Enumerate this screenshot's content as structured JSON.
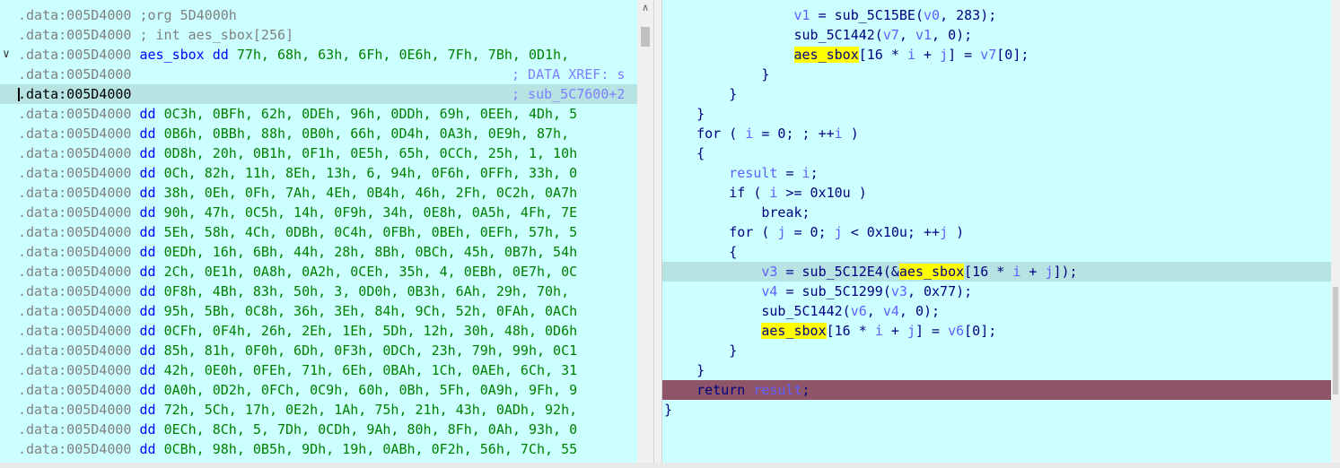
{
  "left": {
    "lines": [
      {
        "addr": ".data:005D4000",
        "rest": " ;org 5D4000h",
        "kind": "gray"
      },
      {
        "addr": ".data:005D4000",
        "rest": " ; int aes_sbox[256]",
        "kind": "gray"
      },
      {
        "addr": ".data:005D4000",
        "name": "aes_sbox",
        "dd": "dd",
        "vals": "77h, 68h, 63h, 6Fh, 0E6h, 7Fh, 7Bh, 0D1h,",
        "kind": "def"
      },
      {
        "addr": ".data:005D4000",
        "comment": "; DATA XREF: s",
        "kind": "comment"
      },
      {
        "addr": ".data:005D4000",
        "comment": "; sub_5C7600+2",
        "kind": "comment"
      },
      {
        "addr": ".data:005D4000",
        "dd": "dd",
        "vals": "0C3h, 0BFh, 62h, 0DEh, 96h, 0DDh, 69h, 0EEh, 4Dh, 5",
        "kind": "dd"
      },
      {
        "addr": ".data:005D4000",
        "dd": "dd",
        "vals": "0B6h, 0BBh, 88h, 0B0h, 66h, 0D4h, 0A3h, 0E9h, 87h,",
        "kind": "dd"
      },
      {
        "addr": ".data:005D4000",
        "dd": "dd",
        "vals": "0D8h, 20h, 0B1h, 0F1h, 0E5h, 65h, 0CCh, 25h, 1, 10h",
        "kind": "dd"
      },
      {
        "addr": ".data:005D4000",
        "dd": "dd",
        "vals": "0Ch, 82h, 11h, 8Eh, 13h, 6, 94h, 0F6h, 0FFh, 33h, 0",
        "kind": "dd"
      },
      {
        "addr": ".data:005D4000",
        "dd": "dd",
        "vals": "38h, 0Eh, 0Fh, 7Ah, 4Eh, 0B4h, 46h, 2Fh, 0C2h, 0A7h",
        "kind": "dd"
      },
      {
        "addr": ".data:005D4000",
        "dd": "dd",
        "vals": "90h, 47h, 0C5h, 14h, 0F9h, 34h, 0E8h, 0A5h, 4Fh, 7E",
        "kind": "dd"
      },
      {
        "addr": ".data:005D4000",
        "dd": "dd",
        "vals": "5Eh, 58h, 4Ch, 0DBh, 0C4h, 0FBh, 0BEh, 0EFh, 57h, 5",
        "kind": "dd"
      },
      {
        "addr": ".data:005D4000",
        "dd": "dd",
        "vals": "0EDh, 16h, 6Bh, 44h, 28h, 8Bh, 0BCh, 45h, 0B7h, 54h",
        "kind": "dd"
      },
      {
        "addr": ".data:005D4000",
        "dd": "dd",
        "vals": "2Ch, 0E1h, 0A8h, 0A2h, 0CEh, 35h, 4, 0EBh, 0E7h, 0C",
        "kind": "dd"
      },
      {
        "addr": ".data:005D4000",
        "dd": "dd",
        "vals": "0F8h, 4Bh, 83h, 50h, 3, 0D0h, 0B3h, 6Ah, 29h, 70h,",
        "kind": "dd"
      },
      {
        "addr": ".data:005D4000",
        "dd": "dd",
        "vals": "95h, 5Bh, 0C8h, 36h, 3Eh, 84h, 9Ch, 52h, 0FAh, 0ACh",
        "kind": "dd"
      },
      {
        "addr": ".data:005D4000",
        "dd": "dd",
        "vals": "0CFh, 0F4h, 26h, 2Eh, 1Eh, 5Dh, 12h, 30h, 48h, 0D6h",
        "kind": "dd"
      },
      {
        "addr": ".data:005D4000",
        "dd": "dd",
        "vals": "85h, 81h, 0F0h, 6Dh, 0F3h, 0DCh, 23h, 79h, 99h, 0C1",
        "kind": "dd"
      },
      {
        "addr": ".data:005D4000",
        "dd": "dd",
        "vals": "42h, 0E0h, 0FEh, 71h, 6Eh, 0BAh, 1Ch, 0AEh, 6Ch, 31",
        "kind": "dd"
      },
      {
        "addr": ".data:005D4000",
        "dd": "dd",
        "vals": "0A0h, 0D2h, 0FCh, 0C9h, 60h, 0Bh, 5Fh, 0A9h, 9Fh, 9",
        "kind": "dd"
      },
      {
        "addr": ".data:005D4000",
        "dd": "dd",
        "vals": "72h, 5Ch, 17h, 0E2h, 1Ah, 75h, 21h, 43h, 0ADh, 92h,",
        "kind": "dd"
      },
      {
        "addr": ".data:005D4000",
        "dd": "dd",
        "vals": "0ECh, 8Ch, 5, 7Dh, 0CDh, 9Ah, 80h, 8Fh, 0Ah, 93h, 0",
        "kind": "dd"
      },
      {
        "addr": ".data:005D4000",
        "dd": "dd",
        "vals": "0CBh, 98h, 0B5h, 9Dh, 19h, 0ABh, 0F2h, 56h, 7Ch, 55",
        "kind": "dd"
      }
    ]
  },
  "right": {
    "lines": [
      {
        "indent": "        ",
        "parts": [
          [
            "var",
            "v1"
          ],
          [
            "plain",
            " = sub_5C15BE("
          ],
          [
            "var",
            "v0"
          ],
          [
            "plain",
            ", 283);"
          ]
        ]
      },
      {
        "indent": "        ",
        "parts": [
          [
            "plain",
            "sub_5C1442("
          ],
          [
            "var",
            "v7"
          ],
          [
            "plain",
            ", "
          ],
          [
            "var",
            "v1"
          ],
          [
            "plain",
            ", 0);"
          ]
        ]
      },
      {
        "indent": "        ",
        "parts": [
          [
            "yhl",
            "aes_sbox"
          ],
          [
            "plain",
            "[16 * "
          ],
          [
            "var",
            "i"
          ],
          [
            "plain",
            " + "
          ],
          [
            "var",
            "j"
          ],
          [
            "plain",
            "] = "
          ],
          [
            "var",
            "v7"
          ],
          [
            "plain",
            "[0];"
          ]
        ]
      },
      {
        "indent": "      ",
        "parts": [
          [
            "plain",
            "}"
          ]
        ]
      },
      {
        "indent": "    ",
        "parts": [
          [
            "plain",
            "}"
          ]
        ]
      },
      {
        "indent": "  ",
        "parts": [
          [
            "plain",
            "}"
          ]
        ]
      },
      {
        "indent": "  ",
        "parts": [
          [
            "plain",
            "for ( "
          ],
          [
            "var",
            "i"
          ],
          [
            "plain",
            " = 0; ; ++"
          ],
          [
            "var",
            "i"
          ],
          [
            "plain",
            " )"
          ]
        ]
      },
      {
        "indent": "  ",
        "parts": [
          [
            "plain",
            "{"
          ]
        ]
      },
      {
        "indent": "    ",
        "parts": [
          [
            "var",
            "result"
          ],
          [
            "plain",
            " = "
          ],
          [
            "var",
            "i"
          ],
          [
            "plain",
            ";"
          ]
        ]
      },
      {
        "indent": "    ",
        "parts": [
          [
            "plain",
            "if ( "
          ],
          [
            "var",
            "i"
          ],
          [
            "plain",
            " >= 0x10u )"
          ]
        ]
      },
      {
        "indent": "      ",
        "parts": [
          [
            "plain",
            "break;"
          ]
        ]
      },
      {
        "indent": "    ",
        "parts": [
          [
            "plain",
            "for ( "
          ],
          [
            "var",
            "j"
          ],
          [
            "plain",
            " = 0; "
          ],
          [
            "var",
            "j"
          ],
          [
            "plain",
            " < 0x10u; ++"
          ],
          [
            "var",
            "j"
          ],
          [
            "plain",
            " )"
          ]
        ]
      },
      {
        "indent": "    ",
        "parts": [
          [
            "plain",
            "{"
          ]
        ]
      },
      {
        "indent": "      ",
        "parts": [
          [
            "var",
            "v3"
          ],
          [
            "plain",
            " = sub_5C12E4(&"
          ],
          [
            "yhl",
            "aes_sbox"
          ],
          [
            "plain",
            "[16 * "
          ],
          [
            "var",
            "i"
          ],
          [
            "plain",
            " + "
          ],
          [
            "var",
            "j"
          ],
          [
            "plain",
            "]);"
          ]
        ],
        "hl": "cur"
      },
      {
        "indent": "      ",
        "parts": [
          [
            "var",
            "v4"
          ],
          [
            "plain",
            " = sub_5C1299("
          ],
          [
            "var",
            "v3"
          ],
          [
            "plain",
            ", 0x77);"
          ]
        ]
      },
      {
        "indent": "      ",
        "parts": [
          [
            "plain",
            "sub_5C1442("
          ],
          [
            "var",
            "v6"
          ],
          [
            "plain",
            ", "
          ],
          [
            "var",
            "v4"
          ],
          [
            "plain",
            ", 0);"
          ]
        ]
      },
      {
        "indent": "      ",
        "parts": [
          [
            "yhl",
            "aes_sbox"
          ],
          [
            "plain",
            "[16 * "
          ],
          [
            "var",
            "i"
          ],
          [
            "plain",
            " + "
          ],
          [
            "var",
            "j"
          ],
          [
            "plain",
            "] = "
          ],
          [
            "var",
            "v6"
          ],
          [
            "plain",
            "[0];"
          ]
        ]
      },
      {
        "indent": "    ",
        "parts": [
          [
            "plain",
            "}"
          ]
        ]
      },
      {
        "indent": "  ",
        "parts": [
          [
            "plain",
            "}"
          ]
        ]
      },
      {
        "indent": "  ",
        "parts": [
          [
            "plain",
            "return "
          ],
          [
            "var",
            "result"
          ],
          [
            "plain",
            ";"
          ]
        ],
        "hl": "red"
      },
      {
        "indent": "",
        "parts": [
          [
            "plain",
            "}"
          ]
        ]
      }
    ]
  }
}
